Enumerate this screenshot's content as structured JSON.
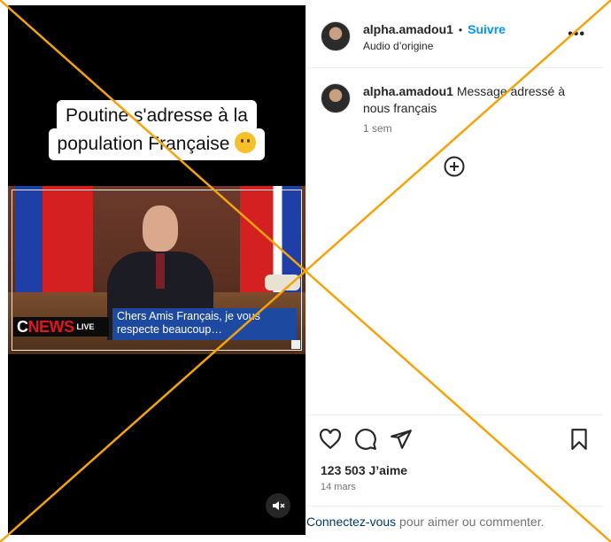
{
  "video": {
    "caption_line1": "Poutine s'adresse à la",
    "caption_line2": "population Française",
    "emoji_icon": "thinking-face-emoji",
    "news_logo_c": "C",
    "news_logo_news": "NEWS",
    "news_live": "LIVE",
    "subtitle": "Chers Amis Français, je vous respecte beaucoup…",
    "mute_icon": "speaker-muted-icon"
  },
  "post": {
    "username": "alpha.amadou1",
    "separator": "•",
    "follow_label": "Suivre",
    "audio_label": "Audio d’origine",
    "more_icon": "more-horizontal-icon",
    "more_label": "•••"
  },
  "comment": {
    "username": "alpha.amadou1",
    "text": "Message adressé à nous français",
    "time": "1 sem"
  },
  "actions": {
    "like_icon": "heart-icon",
    "comment_icon": "comment-icon",
    "share_icon": "send-icon",
    "save_icon": "bookmark-icon",
    "likes_text": "123 503 J’aime",
    "date": "14 mars"
  },
  "footer": {
    "login_link": "Connectez-vous",
    "login_rest": " pour aimer ou commenter."
  },
  "colors": {
    "accent": "#0095f6",
    "overlay_cross": "#f5a30b",
    "cnews_red": "#e4141b",
    "subtitle_bg": "#1d4aa0"
  }
}
